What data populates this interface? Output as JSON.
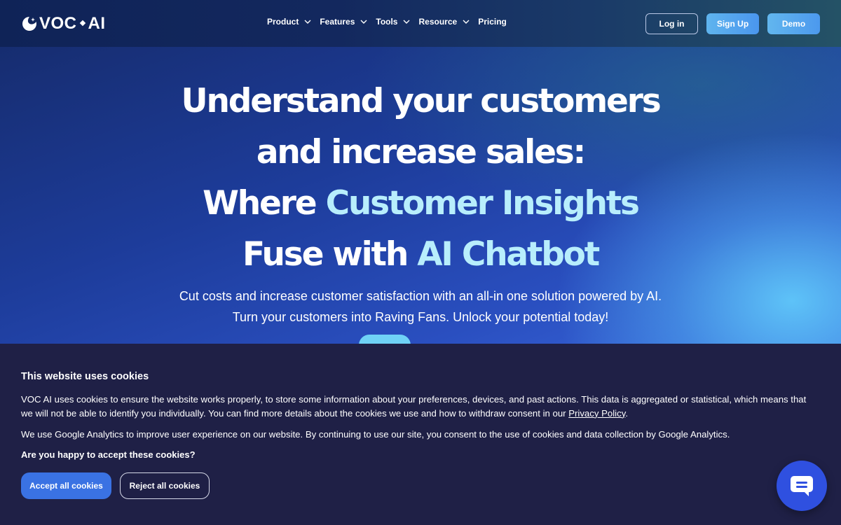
{
  "brand": {
    "name_left": "VOC",
    "name_right": "AI"
  },
  "nav": {
    "items": [
      {
        "label": "Product",
        "has_dropdown": true
      },
      {
        "label": "Features",
        "has_dropdown": true
      },
      {
        "label": "Tools",
        "has_dropdown": true
      },
      {
        "label": "Resource",
        "has_dropdown": true
      },
      {
        "label": "Pricing",
        "has_dropdown": false
      }
    ],
    "login_label": "Log in",
    "signup_label": "Sign Up",
    "demo_label": "Demo"
  },
  "hero": {
    "line1": "Understand your customers",
    "line2": "and increase sales:",
    "line3_prefix": "Where ",
    "line3_accent": "Customer Insights",
    "line4_prefix": "Fuse with ",
    "line4_accent": "AI Chatbot",
    "subtitle_line1": "Cut costs and increase customer satisfaction with an all-in one solution powered by AI.",
    "subtitle_line2": "Turn your customers into Raving Fans. Unlock your potential today!"
  },
  "cookie_banner": {
    "title": "This website uses cookies",
    "paragraph1": "VOC AI uses cookies to ensure the website works properly, to store some information about your preferences, devices, and past actions. This data is aggregated or statistical, which means that we will not be able to identify you individually. You can find more details about the cookies we use and how to withdraw consent in our ",
    "privacy_link": "Privacy Policy",
    "paragraph1_end": ".",
    "paragraph2": "We use Google Analytics to improve user experience on our website. By continuing to use our site, you consent to the use of cookies and data collection by Google Analytics.",
    "question": "Are you happy to accept these cookies?",
    "accept_label": "Accept all cookies",
    "reject_label": "Reject all cookies"
  },
  "colors": {
    "accent_text": "#b8eefc",
    "accept_button": "#3a72e3",
    "cookie_bg": "#1f2046",
    "chat_fab": "#2f50e0"
  }
}
